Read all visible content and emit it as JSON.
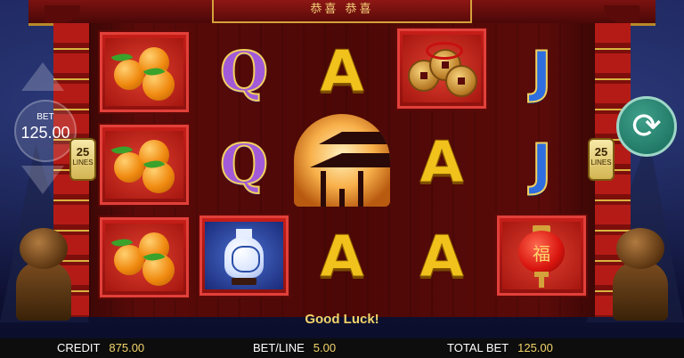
{
  "title": "恭喜 恭喜",
  "bet": {
    "label": "BET",
    "value": "125.00"
  },
  "lines": {
    "count_left": "25",
    "count_right": "25",
    "label": "LINES"
  },
  "message": "Good Luck!",
  "footer": {
    "credit_label": "CREDIT",
    "credit_value": "875.00",
    "betline_label": "BET/LINE",
    "betline_value": "5.00",
    "totalbet_label": "TOTAL BET",
    "totalbet_value": "125.00"
  },
  "reels": [
    [
      "oranges",
      "oranges",
      "oranges"
    ],
    [
      "Q",
      "Q",
      "vase"
    ],
    [
      "A",
      "pagoda",
      "A"
    ],
    [
      "coins",
      "A",
      "A"
    ],
    [
      "J",
      "J",
      "lantern"
    ]
  ],
  "symbol_text": {
    "Q": "Q",
    "A": "A",
    "J": "J",
    "lantern_char": "福"
  },
  "icons": [
    "spin-icon",
    "bet-up-arrow-icon",
    "bet-down-arrow-icon"
  ]
}
